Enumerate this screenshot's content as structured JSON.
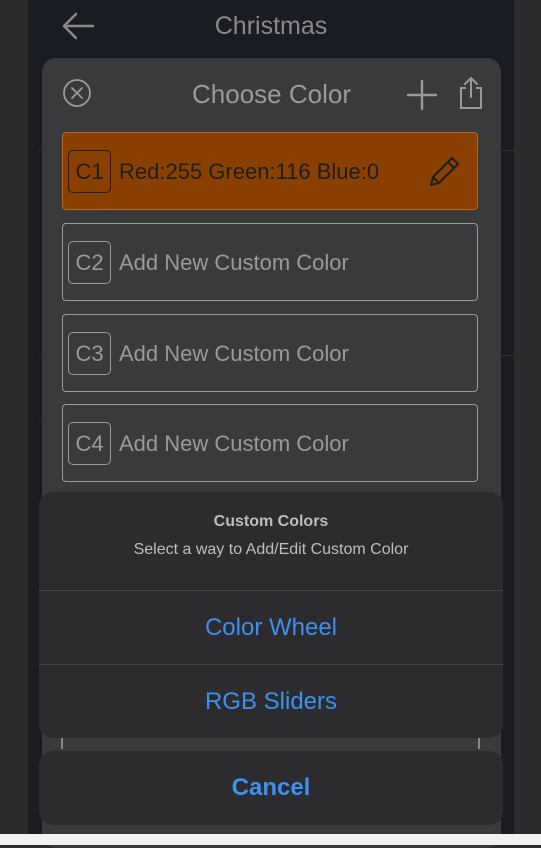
{
  "topbar": {
    "title": "Christmas",
    "back_icon": "arrow-left-icon"
  },
  "sheet": {
    "title": "Choose Color",
    "close_icon": "close-circle-icon",
    "add_icon": "plus-icon",
    "share_icon": "share-icon",
    "colors": [
      {
        "slot": "C1",
        "label": "Red:255 Green:116 Blue:0",
        "swatch": "#8a4000",
        "edit_icon": "pencil-icon"
      },
      {
        "slot": "C2",
        "label": "Add New Custom Color"
      },
      {
        "slot": "C3",
        "label": "Add New Custom Color"
      },
      {
        "slot": "C4",
        "label": "Add New Custom Color"
      }
    ]
  },
  "action_sheet": {
    "title": "Custom Colors",
    "subtitle": "Select a way to Add/Edit Custom Color",
    "options": [
      "Color Wheel",
      "RGB Sliders"
    ],
    "cancel": "Cancel",
    "accent_color": "#3d8ff0"
  }
}
